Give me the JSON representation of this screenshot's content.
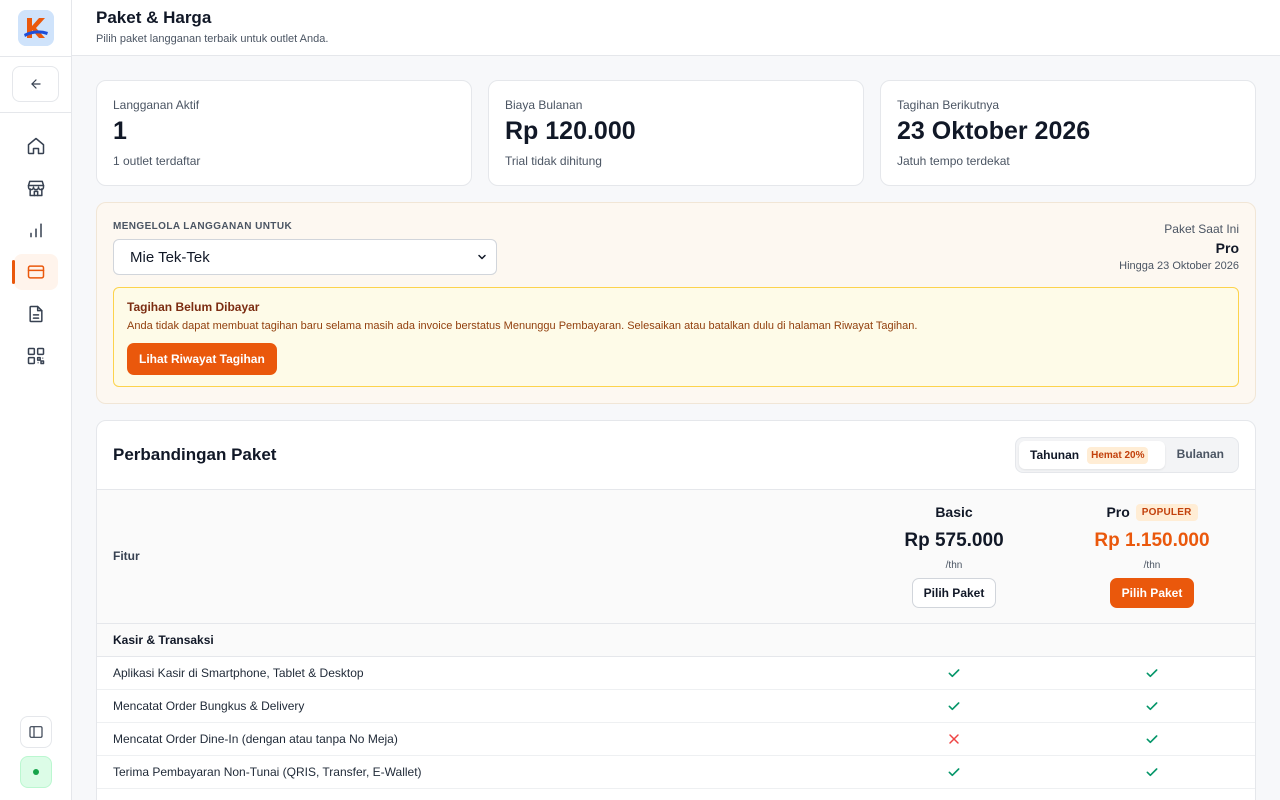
{
  "header": {
    "title": "Paket & Harga",
    "subtitle": "Pilih paket langganan terbaik untuk outlet Anda."
  },
  "sidebar": {
    "logo_icon": "app-logo",
    "back_icon": "arrow-left-icon",
    "items": [
      {
        "icon": "home-icon",
        "active": false
      },
      {
        "icon": "store-icon",
        "active": false
      },
      {
        "icon": "bar-chart-icon",
        "active": false
      },
      {
        "icon": "credit-card-icon",
        "active": true
      },
      {
        "icon": "document-icon",
        "active": false
      },
      {
        "icon": "qr-code-icon",
        "active": false
      }
    ],
    "toggle_icon": "sidebar-panel-icon",
    "status_color": "#16a34a"
  },
  "stats": [
    {
      "label": "Langganan Aktif",
      "value": "1",
      "sub": "1 outlet terdaftar"
    },
    {
      "label": "Biaya Bulanan",
      "value": "Rp 120.000",
      "sub": "Trial tidak dihitung"
    },
    {
      "label": "Tagihan Berikutnya",
      "value": "23 Oktober 2026",
      "sub": "Jatuh tempo terdekat"
    }
  ],
  "manage": {
    "label": "MENGELOLA LANGGANAN UNTUK",
    "selected_outlet": "Mie Tek-Tek",
    "current_plan_label": "Paket Saat Ini",
    "current_plan": "Pro",
    "current_plan_until": "Hingga 23 Oktober 2026",
    "alert": {
      "title": "Tagihan Belum Dibayar",
      "text": "Anda tidak dapat membuat tagihan baru selama masih ada invoice berstatus Menunggu Pembayaran. Selesaikan atau batalkan dulu di halaman Riwayat Tagihan.",
      "button": "Lihat Riwayat Tagihan"
    }
  },
  "comparison": {
    "title": "Perbandingan Paket",
    "toggle": {
      "yearly": "Tahunan",
      "yearly_badge": "Hemat 20%",
      "monthly": "Bulanan",
      "selected": "Tahunan"
    },
    "feature_header": "Fitur",
    "plans": [
      {
        "name": "Basic",
        "badge": "",
        "price": "Rp 575.000",
        "period": "/thn",
        "button": "Pilih Paket"
      },
      {
        "name": "Pro",
        "badge": "POPULER",
        "price": "Rp 1.150.000",
        "period": "/thn",
        "button": "Pilih Paket"
      }
    ],
    "section": "Kasir & Transaksi",
    "features": [
      {
        "label": "Aplikasi Kasir di Smartphone, Tablet & Desktop",
        "basic": true,
        "pro": true
      },
      {
        "label": "Mencatat Order Bungkus & Delivery",
        "basic": true,
        "pro": true
      },
      {
        "label": "Mencatat Order Dine-In (dengan atau tanpa No Meja)",
        "basic": false,
        "pro": true
      },
      {
        "label": "Terima Pembayaran Non-Tunai (QRIS, Transfer, E-Wallet)",
        "basic": true,
        "pro": true
      }
    ]
  },
  "colors": {
    "accent": "#ea580c",
    "check": "#059669",
    "cross": "#ef4444"
  }
}
